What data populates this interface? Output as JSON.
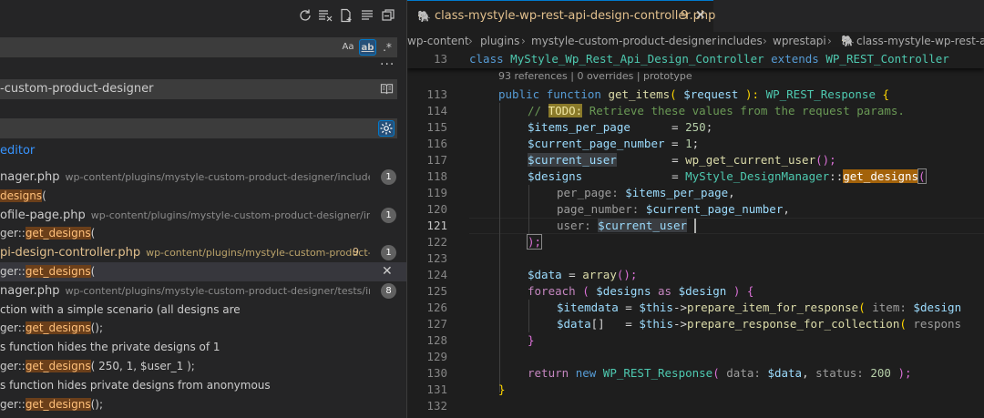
{
  "search_panel": {
    "toolbar_icons": [
      "refresh-icon",
      "clear-results-icon",
      "new-search-editor-icon",
      "collapse-all-icon",
      "view-as-tree-icon"
    ],
    "search_value": "",
    "options": {
      "match_case": "Aa",
      "match_word": "ab",
      "regex": ".*"
    },
    "files_to_include_value": "-custom-product-designer",
    "open_in_editor_label": "editor",
    "results": [
      {
        "kind": "file",
        "name": "nager.php",
        "path": "wp-content/plugins/mystyle-custom-product-designer/includes/en...",
        "badge": "1",
        "modified": false
      },
      {
        "kind": "match",
        "pre": "",
        "hit": "designs",
        "post": "("
      },
      {
        "kind": "file",
        "name": "ofile-page.php",
        "path": "wp-content/plugins/mystyle-custom-product-designer/includ...",
        "badge": "1",
        "modified": false
      },
      {
        "kind": "match",
        "pre": "ger::",
        "hit": "get_designs",
        "post": "("
      },
      {
        "kind": "file",
        "name": "pi-design-controller.php",
        "path": "wp-content/plugins/mystyle-custom-product-...",
        "mcount": "9",
        "badge": "1",
        "modified": true
      },
      {
        "kind": "match",
        "pre": "ger::",
        "hit": "get_designs",
        "post": "(",
        "selected": true
      },
      {
        "kind": "file",
        "name": "nager.php",
        "path": "wp-content/plugins/mystyle-custom-product-designer/tests/includ...",
        "badge": "8",
        "modified": false
      },
      {
        "kind": "match",
        "pre": "ction with a simple scenario (all designs are",
        "hit": "",
        "post": ""
      },
      {
        "kind": "match",
        "pre": "ger::",
        "hit": "get_designs",
        "post": "();"
      },
      {
        "kind": "match",
        "pre": "s function hides the private designs of 1",
        "hit": "",
        "post": ""
      },
      {
        "kind": "match",
        "pre": "ger::",
        "hit": "get_designs",
        "post": "( 250, 1, $user_1 );"
      },
      {
        "kind": "match",
        "pre": "s function hides private designs from anonymous",
        "hit": "",
        "post": ""
      },
      {
        "kind": "match",
        "pre": "ger::",
        "hit": "get_designs",
        "post": "();"
      }
    ]
  },
  "editor": {
    "tab": {
      "title": "class-mystyle-wp-rest-api-design-controller.php",
      "problems": "9"
    },
    "breadcrumb": [
      "wp-content",
      "plugins",
      "mystyle-custom-product-designer",
      "includes",
      "wprestapi",
      "class-mystyle-wp-rest-api"
    ],
    "sticky_line": {
      "number": "13",
      "text": "class MyStyle_Wp_Rest_Api_Design_Controller extends WP_REST_Controller"
    },
    "codelens": "93 references | 0 overrides | prototype",
    "line_numbers": [
      "113",
      "114",
      "115",
      "116",
      "117",
      "118",
      "119",
      "120",
      "121",
      "122",
      "123",
      "124",
      "125",
      "126",
      "127",
      "128",
      "129",
      "130",
      "131",
      "132"
    ],
    "current_line": "121",
    "code": {
      "l113": [
        "public",
        "function",
        "get_items",
        "(",
        "$request",
        "):",
        "WP_REST_Response",
        "{"
      ],
      "l114": [
        "// ",
        "TODO:",
        " Retrieve these values from the request params."
      ],
      "l115": [
        "$items_per_page",
        "= ",
        "250",
        ";"
      ],
      "l116": [
        "$current_page_number",
        "= ",
        "1",
        ";"
      ],
      "l117": [
        "$current_user",
        "= ",
        "wp_get_current_user",
        "();"
      ],
      "l118": [
        "$designs",
        "= ",
        "MyStyle_DesignManager",
        "::",
        "get_designs",
        "("
      ],
      "l119": [
        "per_page:",
        "$items_per_page",
        ","
      ],
      "l120": [
        "page_number:",
        "$current_page_number",
        ","
      ],
      "l121": [
        "user:",
        "$current_user"
      ],
      "l122": [
        ");"
      ],
      "l124": [
        "$data",
        "= ",
        "array",
        "();"
      ],
      "l125": [
        "foreach",
        "(",
        "$designs",
        "as",
        "$design",
        ")",
        "{"
      ],
      "l126": [
        "$itemdata",
        "= ",
        "$this",
        "->",
        "prepare_item_for_response",
        "(",
        "item:",
        "$design"
      ],
      "l127": [
        "$data",
        "[]",
        "= ",
        "$this",
        "->",
        "prepare_response_for_collection",
        "(",
        "respons"
      ],
      "l128": [
        "}"
      ],
      "l130": [
        "return",
        "new",
        "WP_REST_Response",
        "(",
        "data:",
        "$data",
        ",",
        "status:",
        "200",
        ");"
      ],
      "l131": [
        "}"
      ]
    }
  }
}
